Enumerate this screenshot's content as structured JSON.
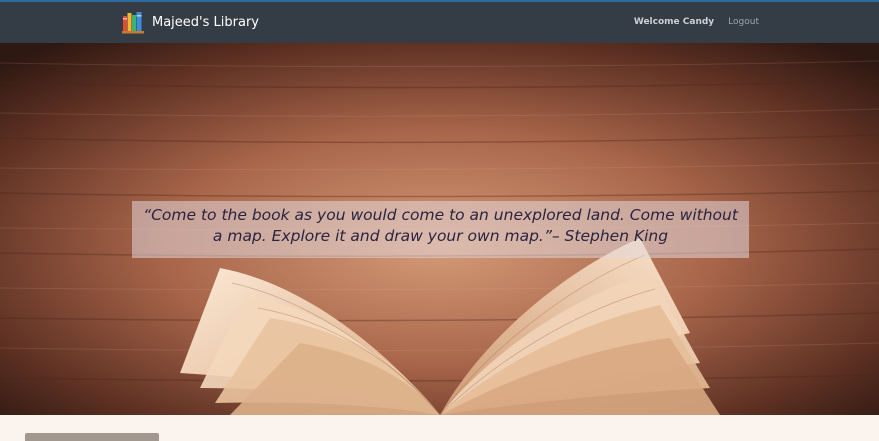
{
  "navbar": {
    "brand_name": "Majeed's Library",
    "brand_logo_icon": "books-icon",
    "welcome_text": "Welcome Candy",
    "logout_label": "Logout",
    "bg_color": "#343d46"
  },
  "hero": {
    "background_image": "open-book-on-wooden-table",
    "quote": "“Come to the book as you would come to an unexplored land. Come without a map. Explore it and draw your own map.”– Stephen King"
  },
  "colors": {
    "page_bg": "#fbf3ee",
    "quote_box": "rgba(225,215,218,0.55)",
    "quote_text": "#2a2440"
  }
}
